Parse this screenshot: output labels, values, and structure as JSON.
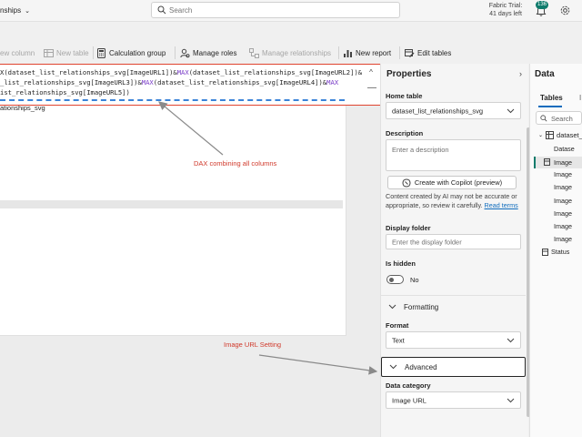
{
  "header": {
    "app_title_fragment": "nships",
    "search_placeholder": "Search",
    "trial_line1": "Fabric Trial:",
    "trial_line2": "41 days left",
    "notification_count": "136"
  },
  "ribbon": {
    "new_column": "ew column",
    "new_table": "New table",
    "calculation_group": "Calculation group",
    "manage_roles": "Manage roles",
    "manage_relationships": "Manage relationships",
    "new_report": "New report",
    "edit_tables": "Edit tables"
  },
  "dax": {
    "line1_a": "X(dataset_list_relationships_svg[ImageURL1])&",
    "line1_b": "MAX",
    "line1_c": "(dataset_list_relationships_svg[ImageURL2])&",
    "line2_a": "_list_relationships_svg[ImageURL3])&",
    "line2_b": "MAX",
    "line2_c": "(dataset_list_relationships_svg[ImageURL4])&",
    "line2_d": "MAX",
    "line3": "ist_relationships_svg[ImageURL5])"
  },
  "canvas": {
    "table_card_title": "ationships_svg"
  },
  "annotations": {
    "dax_note": "DAX combining all columns",
    "url_note": "Image URL Setting"
  },
  "properties": {
    "title": "Properties",
    "home_table_label": "Home table",
    "home_table_value": "dataset_list_relationships_svg",
    "description_label": "Description",
    "description_placeholder": "Enter a description",
    "copilot_button": "Create with Copilot (preview)",
    "disclaimer": "Content created by AI may not be accurate or appropriate, so review it carefully.",
    "disclaimer_link": "Read terms",
    "display_folder_label": "Display folder",
    "display_folder_placeholder": "Enter the display folder",
    "is_hidden_label": "Is hidden",
    "is_hidden_value": "No",
    "formatting_section": "Formatting",
    "format_label": "Format",
    "format_value": "Text",
    "advanced_section": "Advanced",
    "data_category_label": "Data category",
    "data_category_value": "Image URL"
  },
  "data_pane": {
    "title": "Data",
    "tab_tables": "Tables",
    "tab_other": "I",
    "search_placeholder": "Search",
    "root": "dataset_li",
    "items": [
      "Datase",
      "Image",
      "Image",
      "Image",
      "Image",
      "Image",
      "Image",
      "Image",
      "Status"
    ]
  },
  "colors": {
    "highlight_border": "#e0442f",
    "annotation_text": "#d0392b",
    "accent": "#0f6cbd",
    "badge": "#0f7b6c"
  }
}
